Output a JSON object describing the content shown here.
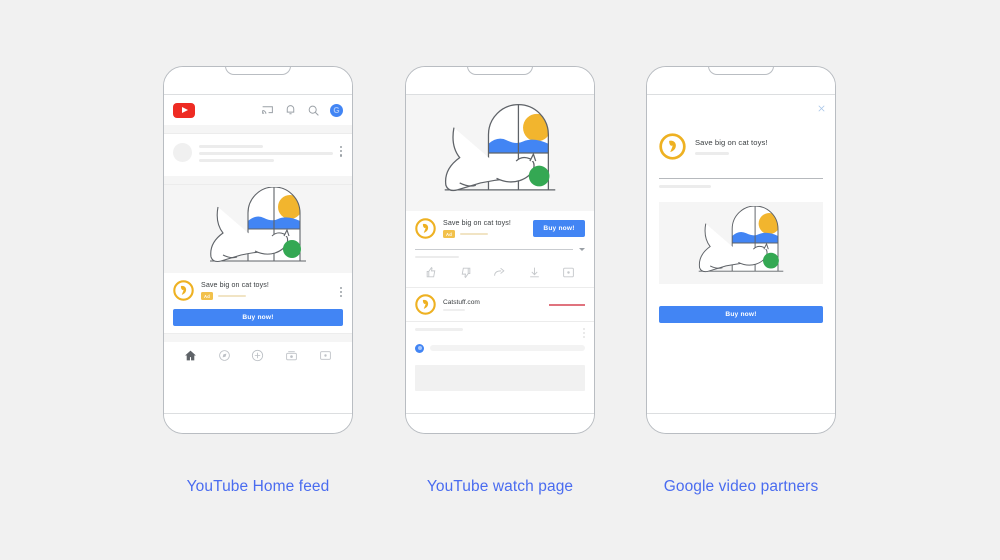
{
  "page": {
    "background_color": "#f1f1f1",
    "caption_color": "#4a6cf0",
    "accent_blue": "#4285f4",
    "youtube_red": "#ee2b23",
    "ad_badge_color": "#f2c14b",
    "brand_gold": "#eeb122"
  },
  "captions": {
    "phone1": "YouTube Home feed",
    "phone2": "YouTube watch page",
    "phone3": "Google video partners"
  },
  "phone1": {
    "header": {
      "logo_label": "YouTube",
      "icons": [
        "cast-icon",
        "bell-icon",
        "search-icon"
      ],
      "avatar_letter": "G"
    },
    "ad": {
      "title": "Save big on cat toys!",
      "badge": "Ad",
      "cta": "Buy now!"
    },
    "bottom_nav": [
      "home-icon",
      "explore-icon",
      "create-icon",
      "subscriptions-icon",
      "library-icon"
    ]
  },
  "phone2": {
    "ad": {
      "title": "Save big on cat toys!",
      "badge": "Ad",
      "cta": "Buy now!"
    },
    "actions": [
      "like-icon",
      "dislike-icon",
      "share-icon",
      "download-icon",
      "save-icon"
    ],
    "channel": {
      "name": "Catstuff.com"
    }
  },
  "phone3": {
    "close_label": "×",
    "ad": {
      "title": "Save big on cat toys!",
      "cta": "Buy now!"
    }
  },
  "illustration": {
    "name": "cat-in-window-illustration",
    "sun_color": "#f2b52e",
    "hills_color": "#4285f4",
    "ball_color": "#34a853",
    "outline_color": "#5f6368"
  }
}
